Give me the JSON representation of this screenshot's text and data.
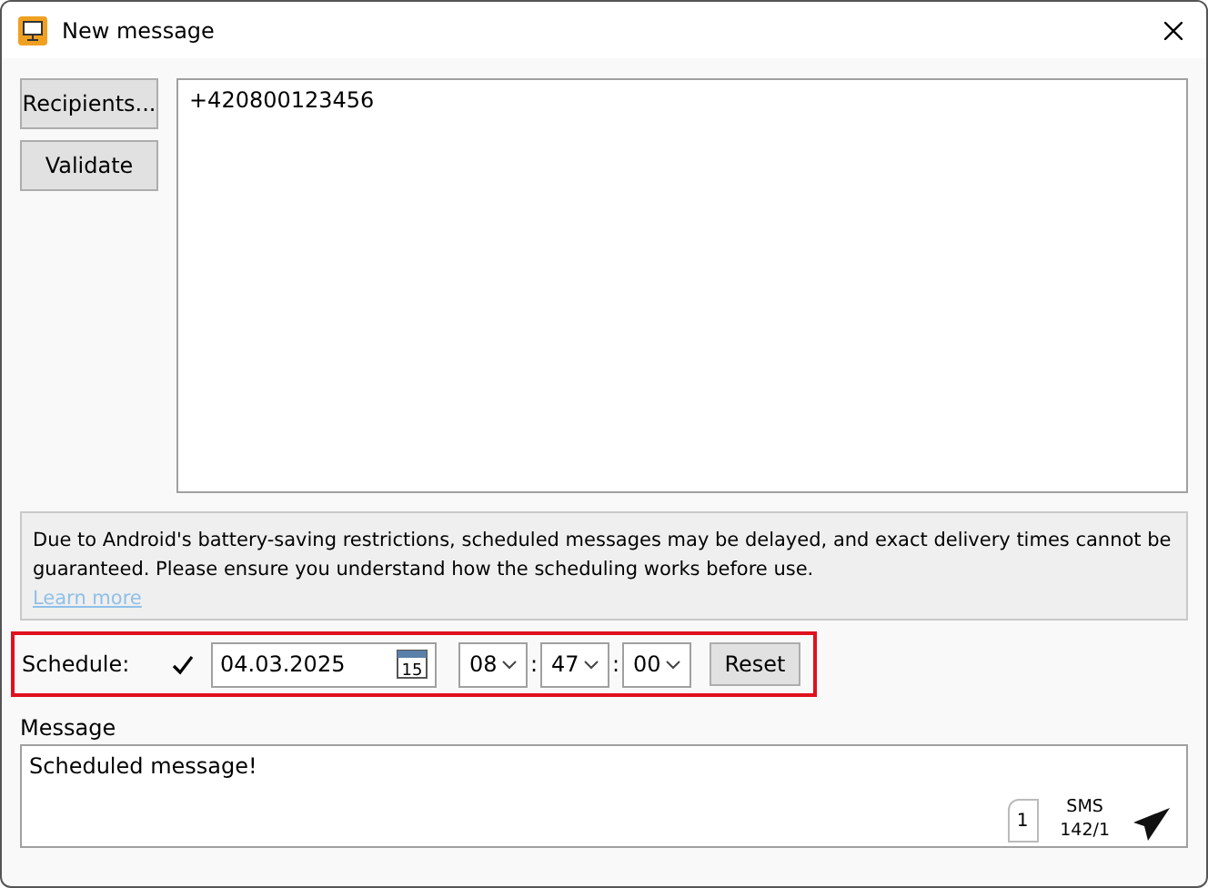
{
  "window": {
    "title": "New message"
  },
  "buttons": [
    {
      "label": "Recipients..."
    },
    {
      "label": "Validate"
    }
  ],
  "recipients": {
    "value": "+420800123456"
  },
  "notice": {
    "text": "Due to Android's battery-saving restrictions, scheduled messages may be delayed, and exact delivery times cannot be guaranteed. Please ensure you understand how the scheduling works before use.",
    "link": "Learn more"
  },
  "schedule": {
    "label": "Schedule:",
    "checked": true,
    "date": "04.03.2025",
    "calendar_day": "15",
    "hour": "08",
    "minute": "47",
    "second": "00",
    "separator": ":",
    "reset": "Reset"
  },
  "message": {
    "label": "Message",
    "value": "Scheduled message!",
    "pages": "1",
    "type": "SMS",
    "counter": "142/1"
  }
}
